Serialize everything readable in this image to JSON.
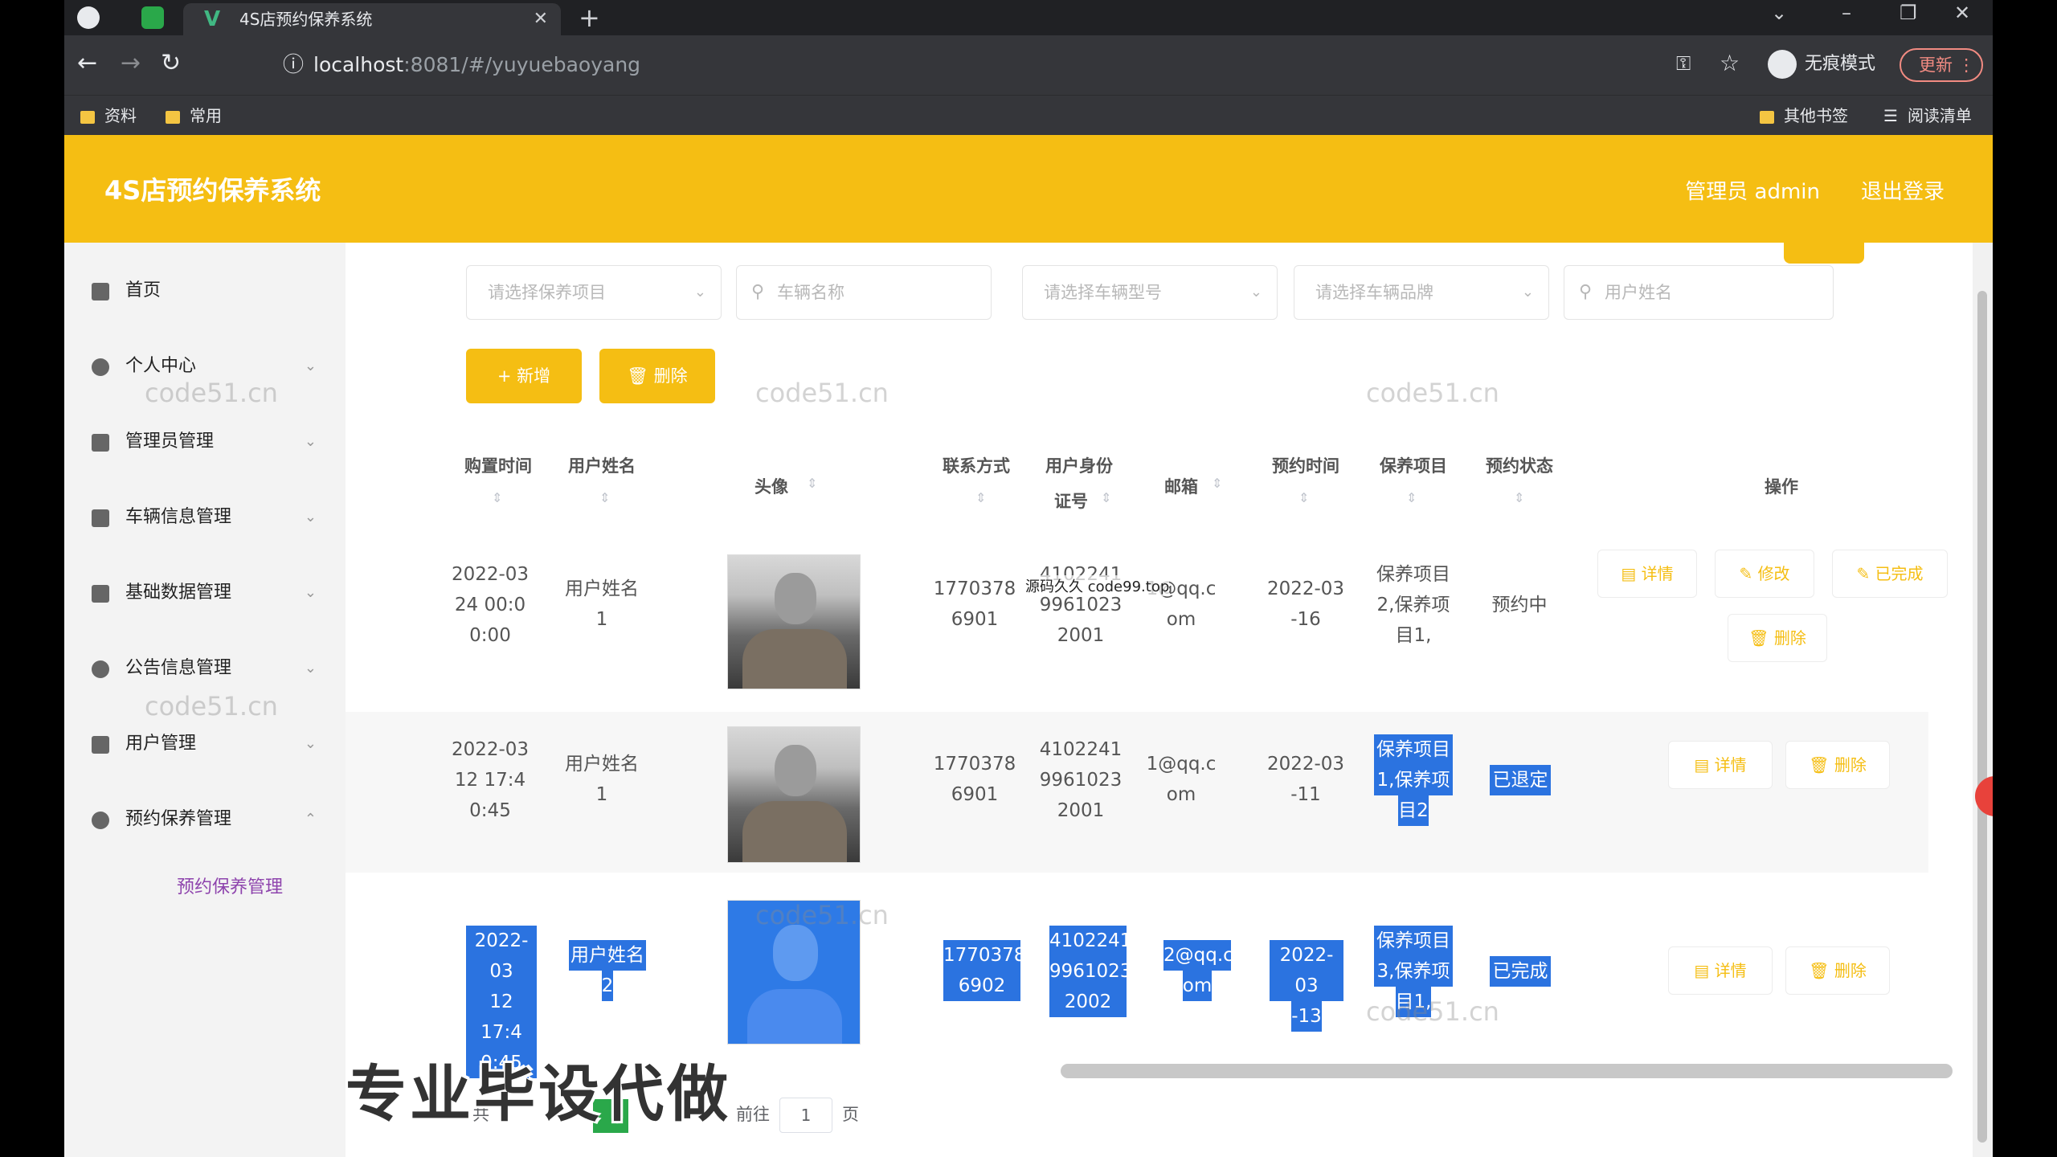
{
  "browser": {
    "tab_title": "4S店预约保养系统",
    "url_host": "localhost",
    "url_rest": ":8081/#/yuyuebaoyang",
    "incognito_label": "无痕模式",
    "update_label": "更新",
    "bookmarks": [
      "资料",
      "常用"
    ],
    "bookmarks_right": [
      "其他书签",
      "阅读清单"
    ]
  },
  "header": {
    "title": "4S店预约保养系统",
    "user": "管理员 admin",
    "logout": "退出登录"
  },
  "sidebar": {
    "items": [
      {
        "label": "首页",
        "icon": "home-icon",
        "has_chevron": false
      },
      {
        "label": "个人中心",
        "icon": "user-icon",
        "has_chevron": true
      },
      {
        "label": "管理员管理",
        "icon": "list-icon",
        "has_chevron": true
      },
      {
        "label": "车辆信息管理",
        "icon": "calendar-icon",
        "has_chevron": true
      },
      {
        "label": "基础数据管理",
        "icon": "list-icon",
        "has_chevron": true
      },
      {
        "label": "公告信息管理",
        "icon": "info-icon",
        "has_chevron": true
      },
      {
        "label": "用户管理",
        "icon": "monitor-icon",
        "has_chevron": true
      },
      {
        "label": "预约保养管理",
        "icon": "location-icon",
        "has_chevron": true,
        "expanded": true
      }
    ],
    "sub_items": [
      "预约保养管理"
    ]
  },
  "filters": {
    "project": "请选择保养项目",
    "car_name": "车辆名称",
    "car_model": "请选择车辆型号",
    "car_brand": "请选择车辆品牌",
    "user_name": "用户姓名"
  },
  "actions": {
    "add": "+ 新增",
    "delete": "删除"
  },
  "table": {
    "headers": {
      "time": "购置时间",
      "name": "用户姓名",
      "avatar": "头像",
      "phone": "联系方式",
      "idcard_1": "用户身份",
      "idcard_2": "证号",
      "email": "邮箱",
      "appt_time": "预约时间",
      "project": "保养项目",
      "status": "预约状态",
      "ops": "操作"
    },
    "rows": [
      {
        "time": [
          "2022-03",
          "24 00:0",
          "0:00"
        ],
        "name": [
          "用户姓名",
          "1"
        ],
        "phone": [
          "1770378",
          "6901"
        ],
        "idcard": [
          "4102241",
          "9961023",
          "2001"
        ],
        "email": [
          "1@qq.c",
          "om"
        ],
        "appt_time": [
          "2022-03",
          "-16"
        ],
        "project": [
          "保养项目",
          "2,保养项",
          "目1,"
        ],
        "status": "预约中",
        "ops": [
          "详情",
          "修改",
          "已完成",
          "删除"
        ]
      },
      {
        "time": [
          "2022-03",
          "12 17:4",
          "0:45"
        ],
        "name": [
          "用户姓名",
          "1"
        ],
        "phone": [
          "1770378",
          "6901"
        ],
        "idcard": [
          "4102241",
          "9961023",
          "2001"
        ],
        "email": [
          "1@qq.c",
          "om"
        ],
        "appt_time": [
          "2022-03",
          "-11"
        ],
        "project": [
          "保养项目",
          "1,保养项",
          "目2"
        ],
        "status": "已退定",
        "ops": [
          "详情",
          "删除"
        ]
      },
      {
        "time": [
          "2022-03",
          "12 17:4",
          "0:45"
        ],
        "name": [
          "用户姓名",
          "2"
        ],
        "phone": [
          "1770378",
          "6902"
        ],
        "idcard": [
          "4102241",
          "9961023",
          "2002"
        ],
        "email": [
          "2@qq.c",
          "om"
        ],
        "appt_time": [
          "2022-03",
          "-13"
        ],
        "project": [
          "保养项目",
          "3,保养项",
          "目1,"
        ],
        "status": "已完成",
        "ops": [
          "详情",
          "删除"
        ]
      }
    ]
  },
  "pagination": {
    "total_prefix": "共",
    "goto_label": "前往",
    "page_value": "1",
    "page_suffix": "页"
  },
  "overlay": {
    "caption": "专业毕设代做",
    "source_note": "源码久久 code99.top",
    "watermark": "code51.cn"
  },
  "colors": {
    "brand": "#f5be13",
    "selection": "#2b73e0",
    "submenu_active": "#8e44ad"
  }
}
